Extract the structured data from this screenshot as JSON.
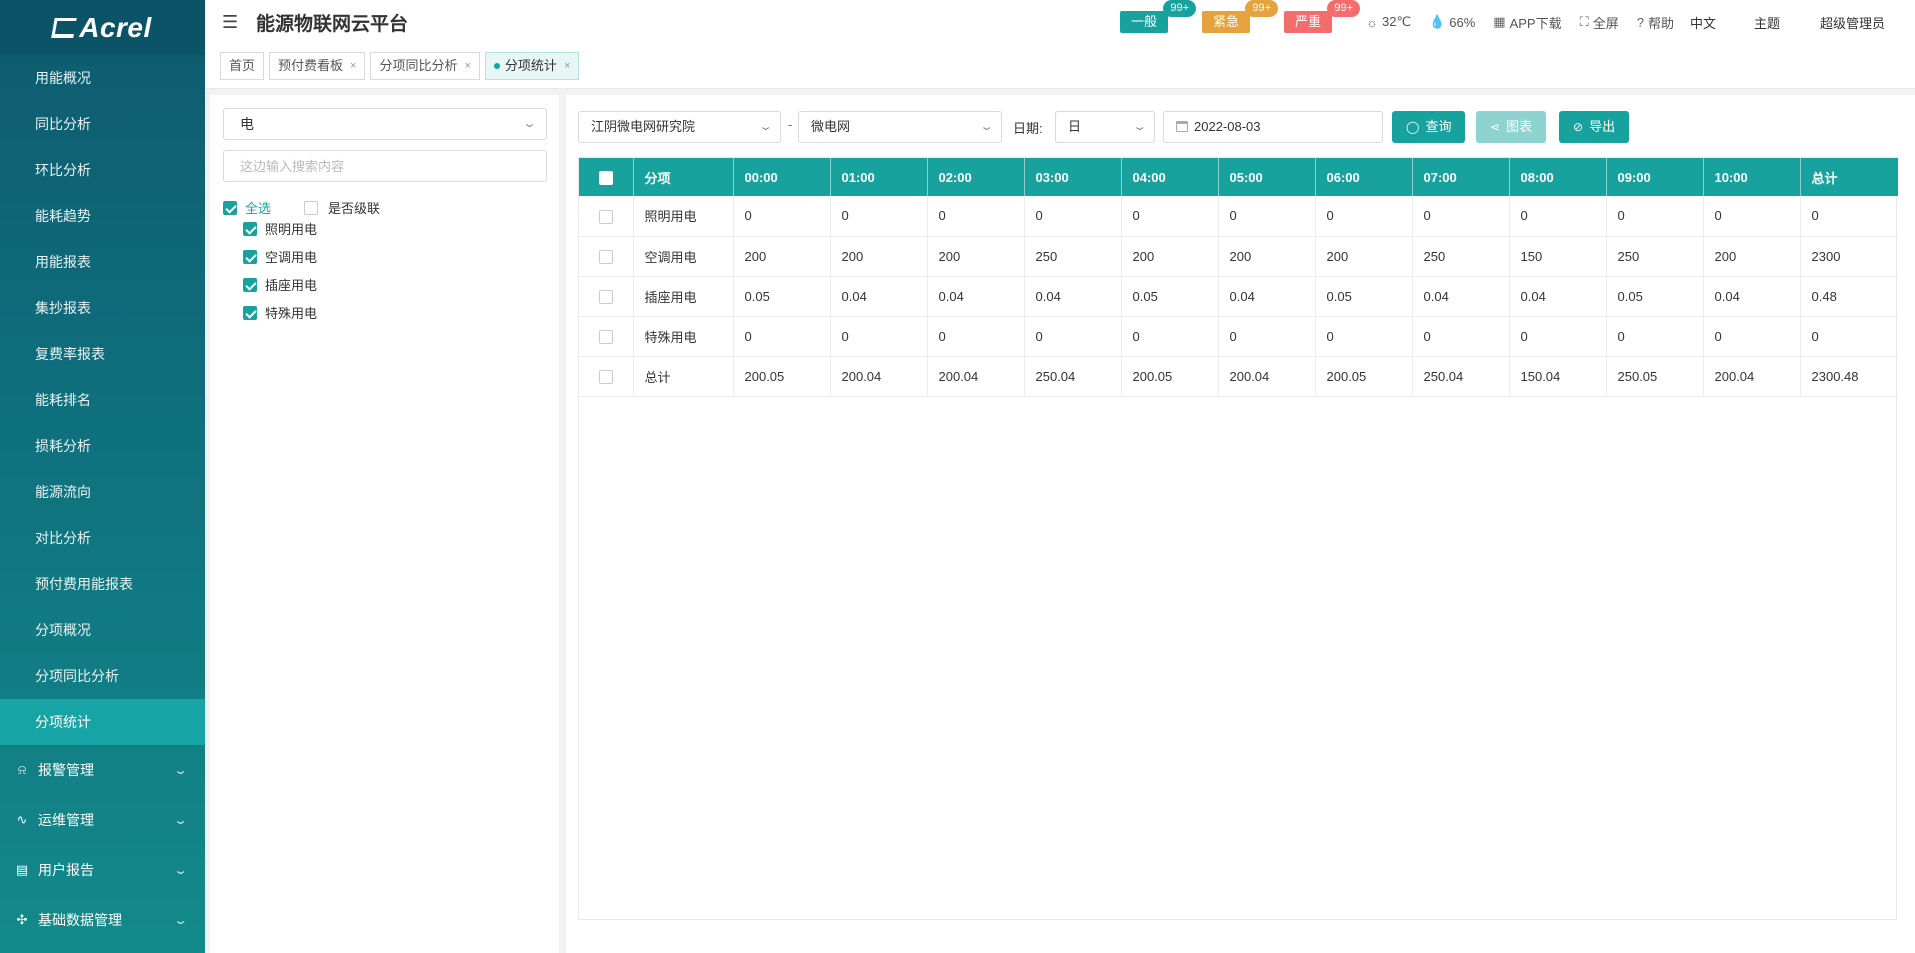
{
  "app": {
    "logo": "Acrel",
    "title": "能源物联网云平台"
  },
  "sidebar": {
    "items": [
      {
        "label": "用能概况"
      },
      {
        "label": "同比分析"
      },
      {
        "label": "环比分析"
      },
      {
        "label": "能耗趋势"
      },
      {
        "label": "用能报表"
      },
      {
        "label": "集抄报表"
      },
      {
        "label": "复费率报表"
      },
      {
        "label": "能耗排名"
      },
      {
        "label": "损耗分析"
      },
      {
        "label": "能源流向"
      },
      {
        "label": "对比分析"
      },
      {
        "label": "预付费用能报表"
      },
      {
        "label": "分项概况"
      },
      {
        "label": "分项同比分析"
      },
      {
        "label": "分项统计",
        "active": true
      }
    ],
    "groups": [
      {
        "label": "报警管理",
        "icon": "bell-icon"
      },
      {
        "label": "运维管理",
        "icon": "wrench-icon"
      },
      {
        "label": "用户报告",
        "icon": "report-icon"
      },
      {
        "label": "基础数据管理",
        "icon": "data-icon"
      }
    ]
  },
  "header": {
    "alarms": [
      {
        "label": "一般",
        "count": "99+",
        "color": "#17a29e",
        "badge_color": "#17a29e"
      },
      {
        "label": "紧急",
        "count": "99+",
        "color": "#e6a23c",
        "badge_color": "#e6a23c"
      },
      {
        "label": "严重",
        "count": "99+",
        "color": "#f56c6c",
        "badge_color": "#f56c6c"
      }
    ],
    "weather": "32℃",
    "humidity": "66%",
    "app_download": "APP下载",
    "fullscreen": "全屏",
    "help": "帮助",
    "language": "中文",
    "theme": "主题",
    "user": "超级管理员"
  },
  "tabs": [
    {
      "label": "首页",
      "closable": false
    },
    {
      "label": "预付费看板",
      "closable": true
    },
    {
      "label": "分项同比分析",
      "closable": true
    },
    {
      "label": "分项统计",
      "closable": true,
      "active": true
    }
  ],
  "left_panel": {
    "energy_type": "电",
    "search_placeholder": "这边输入搜索内容",
    "select_all": "全选",
    "cascade": "是否级联",
    "tree": [
      "照明用电",
      "空调用电",
      "插座用电",
      "特殊用电"
    ]
  },
  "filters": {
    "site": "江阴微电网研究院",
    "separator": "-",
    "network": "微电网",
    "date_label": "日期:",
    "period": "日",
    "date": "2022-08-03",
    "query_button": "查询",
    "chart_button": "图表",
    "export_button": "导出"
  },
  "table": {
    "columns": [
      "分项",
      "00:00",
      "01:00",
      "02:00",
      "03:00",
      "04:00",
      "05:00",
      "06:00",
      "07:00",
      "08:00",
      "09:00",
      "10:00",
      "总计"
    ],
    "rows": [
      [
        "照明用电",
        "0",
        "0",
        "0",
        "0",
        "0",
        "0",
        "0",
        "0",
        "0",
        "0",
        "0",
        "0"
      ],
      [
        "空调用电",
        "200",
        "200",
        "200",
        "250",
        "200",
        "200",
        "200",
        "250",
        "150",
        "250",
        "200",
        "2300"
      ],
      [
        "插座用电",
        "0.05",
        "0.04",
        "0.04",
        "0.04",
        "0.05",
        "0.04",
        "0.05",
        "0.04",
        "0.04",
        "0.05",
        "0.04",
        "0.48"
      ],
      [
        "特殊用电",
        "0",
        "0",
        "0",
        "0",
        "0",
        "0",
        "0",
        "0",
        "0",
        "0",
        "0",
        "0"
      ],
      [
        "总计",
        "200.05",
        "200.04",
        "200.04",
        "250.04",
        "200.05",
        "200.04",
        "200.05",
        "250.04",
        "150.04",
        "250.05",
        "200.04",
        "2300.48"
      ]
    ]
  }
}
